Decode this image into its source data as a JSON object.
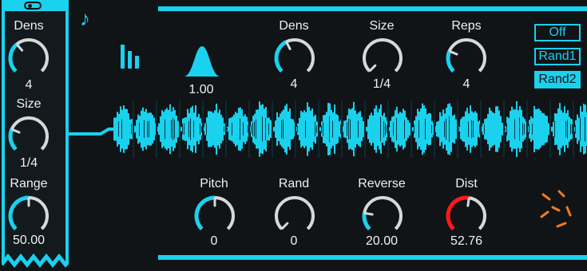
{
  "colors": {
    "accent": "#1ad1ee",
    "track": "#d8d8d8",
    "warn": "#ff1a1a",
    "dice": "#f07b22",
    "bg": "#101417"
  },
  "left_panel": {
    "toggle_icon": "toggle-switch-icon",
    "knobs": [
      {
        "label": "Dens",
        "value": "4",
        "fraction": 0.35
      },
      {
        "label": "Size",
        "value": "1/4",
        "fraction": 0.25
      },
      {
        "label": "Range",
        "value": "50.00",
        "fraction": 0.5
      }
    ]
  },
  "top_knobs": [
    {
      "label": "Dens",
      "value": "4",
      "fraction": 0.4
    },
    {
      "label": "Size",
      "value": "1/4",
      "fraction": 0.0
    },
    {
      "label": "Reps",
      "value": "4",
      "fraction": 0.25
    }
  ],
  "bottom_knobs": [
    {
      "label": "Pitch",
      "value": "0",
      "fraction": 0.5
    },
    {
      "label": "Rand",
      "value": "0",
      "fraction": 0.0
    },
    {
      "label": "Reverse",
      "value": "20.00",
      "fraction": 0.2
    },
    {
      "label": "Dist",
      "value": "52.76",
      "fraction": 0.53,
      "color": "warn"
    }
  ],
  "envelope": {
    "value": "1.00",
    "icon": "bell-curve-icon"
  },
  "icons": {
    "note": "music-note-icon",
    "bars": "bar-levels-icon",
    "dice": "randomize-icon"
  },
  "modes": {
    "options": [
      "Off",
      "Rand1",
      "Rand2"
    ],
    "selected": "Rand2"
  }
}
